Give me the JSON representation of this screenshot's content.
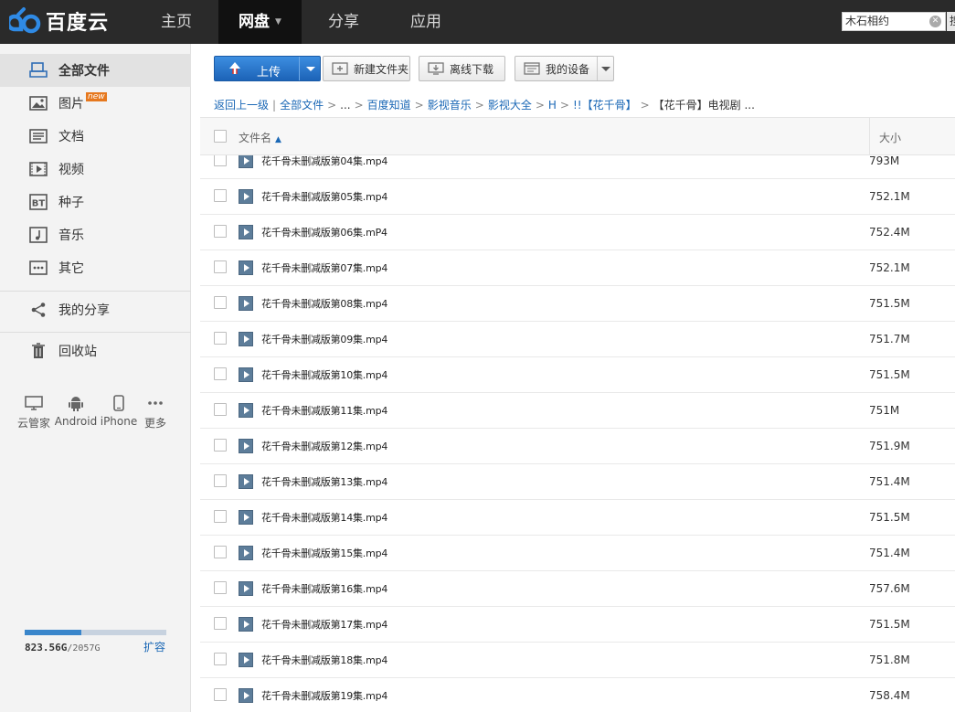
{
  "app": {
    "logo_text": "百度云",
    "nav": [
      "主页",
      "网盘",
      "分享",
      "应用"
    ],
    "search_value": "木石相约",
    "search_button_label": "搜"
  },
  "sidebar": {
    "items": [
      {
        "label": "全部文件",
        "icon": "all-files-icon"
      },
      {
        "label": "图片",
        "icon": "image-icon",
        "badge": "new"
      },
      {
        "label": "文档",
        "icon": "document-icon"
      },
      {
        "label": "视频",
        "icon": "video-icon"
      },
      {
        "label": "种子",
        "icon": "bt-icon"
      },
      {
        "label": "音乐",
        "icon": "music-icon"
      },
      {
        "label": "其它",
        "icon": "other-icon"
      },
      {
        "label": "我的分享",
        "icon": "share-icon"
      },
      {
        "label": "回收站",
        "icon": "trash-icon"
      }
    ],
    "devices": [
      {
        "label": "云管家",
        "icon": "monitor-icon"
      },
      {
        "label": "Android",
        "icon": "android-icon"
      },
      {
        "label": "iPhone",
        "icon": "phone-icon"
      },
      {
        "label": "更多",
        "icon": "more-icon"
      }
    ],
    "quota": {
      "used": "823.56G",
      "total": "/2057G",
      "used_fraction": 0.4,
      "expand_label": "扩容"
    }
  },
  "toolbar": {
    "upload_label": "上传",
    "new_folder_label": "新建文件夹",
    "offline_download_label": "离线下载",
    "my_devices_label": "我的设备"
  },
  "breadcrumb": {
    "back": "返回上一级",
    "items": [
      "全部文件",
      "...",
      "百度知道",
      "影视音乐",
      "影视大全",
      "H",
      "!!【花千骨】"
    ],
    "current": "【花千骨】电视剧 ..."
  },
  "table": {
    "col_name": "文件名",
    "col_size": "大小",
    "rows": [
      {
        "name": "花千骨未删减版第04集.mp4",
        "size": "793M"
      },
      {
        "name": "花千骨未删减版第05集.mp4",
        "size": "752.1M"
      },
      {
        "name": "花千骨未删减版第06集.mP4",
        "size": "752.4M"
      },
      {
        "name": "花千骨未删减版第07集.mp4",
        "size": "752.1M"
      },
      {
        "name": "花千骨未删减版第08集.mp4",
        "size": "751.5M"
      },
      {
        "name": "花千骨未删减版第09集.mp4",
        "size": "751.7M"
      },
      {
        "name": "花千骨未删减版第10集.mp4",
        "size": "751.5M"
      },
      {
        "name": "花千骨未删减版第11集.mp4",
        "size": "751M"
      },
      {
        "name": "花千骨未删减版第12集.mp4",
        "size": "751.9M"
      },
      {
        "name": "花千骨未删减版第13集.mp4",
        "size": "751.4M"
      },
      {
        "name": "花千骨未删减版第14集.mp4",
        "size": "751.5M"
      },
      {
        "name": "花千骨未删减版第15集.mp4",
        "size": "751.4M"
      },
      {
        "name": "花千骨未删减版第16集.mp4",
        "size": "757.6M"
      },
      {
        "name": "花千骨未删减版第17集.mp4",
        "size": "751.5M"
      },
      {
        "name": "花千骨未删减版第18集.mp4",
        "size": "751.8M"
      },
      {
        "name": "花千骨未删减版第19集.mp4",
        "size": "758.4M"
      }
    ]
  },
  "colors": {
    "accent": "#1b68b6",
    "topbar": "#2a2a2a",
    "upload": "#2b7ad0"
  }
}
